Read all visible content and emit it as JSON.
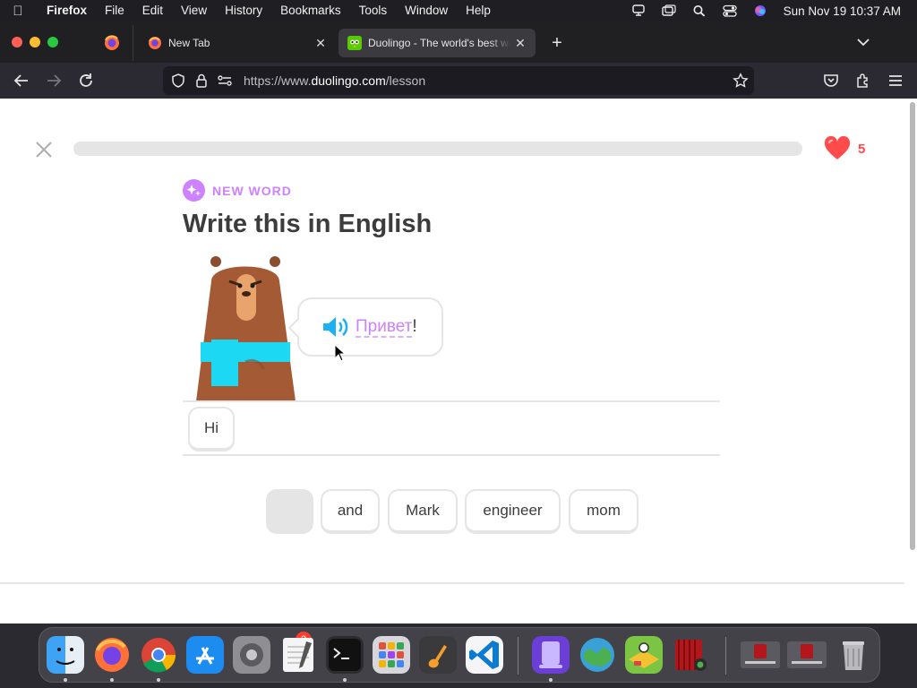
{
  "menubar": {
    "app_name": "Firefox",
    "menus": [
      "File",
      "Edit",
      "View",
      "History",
      "Bookmarks",
      "Tools",
      "Window",
      "Help"
    ],
    "clock": "Sun Nov 19  10:37 AM"
  },
  "tabs": {
    "inactive_title": "New Tab",
    "active_title": "Duolingo - The world's best way to learn a language"
  },
  "address": {
    "prefix": "https://www.",
    "domain": "duolingo.com",
    "path": "/lesson"
  },
  "lesson": {
    "progress_fraction": 0,
    "hearts": "5",
    "tag": "NEW WORD",
    "heading": "Write this in English",
    "prompt_word": "Привет",
    "prompt_punct": "!",
    "selected_words": [
      "Hi"
    ],
    "word_bank": [
      "and",
      "Mark",
      "engineer",
      "mom"
    ]
  },
  "colors": {
    "progress_green": "#58cc02",
    "heart_red": "#ff4b4b",
    "tag_purple": "#ce82ff",
    "speaker_blue": "#1cb0f6"
  },
  "dock": {
    "icons": [
      "finder-icon",
      "firefox-icon",
      "chrome-icon",
      "app-store-icon",
      "system-settings-icon",
      "textedit-icon",
      "terminal-icon",
      "launchpad-icon",
      "garageband-icon",
      "vscode-icon",
      "simulator-icon",
      "minecraft-icon",
      "game-icon",
      "photo-booth-icon",
      "window-1-icon",
      "window-2-icon",
      "trash-icon"
    ],
    "settings_badge": "2"
  }
}
